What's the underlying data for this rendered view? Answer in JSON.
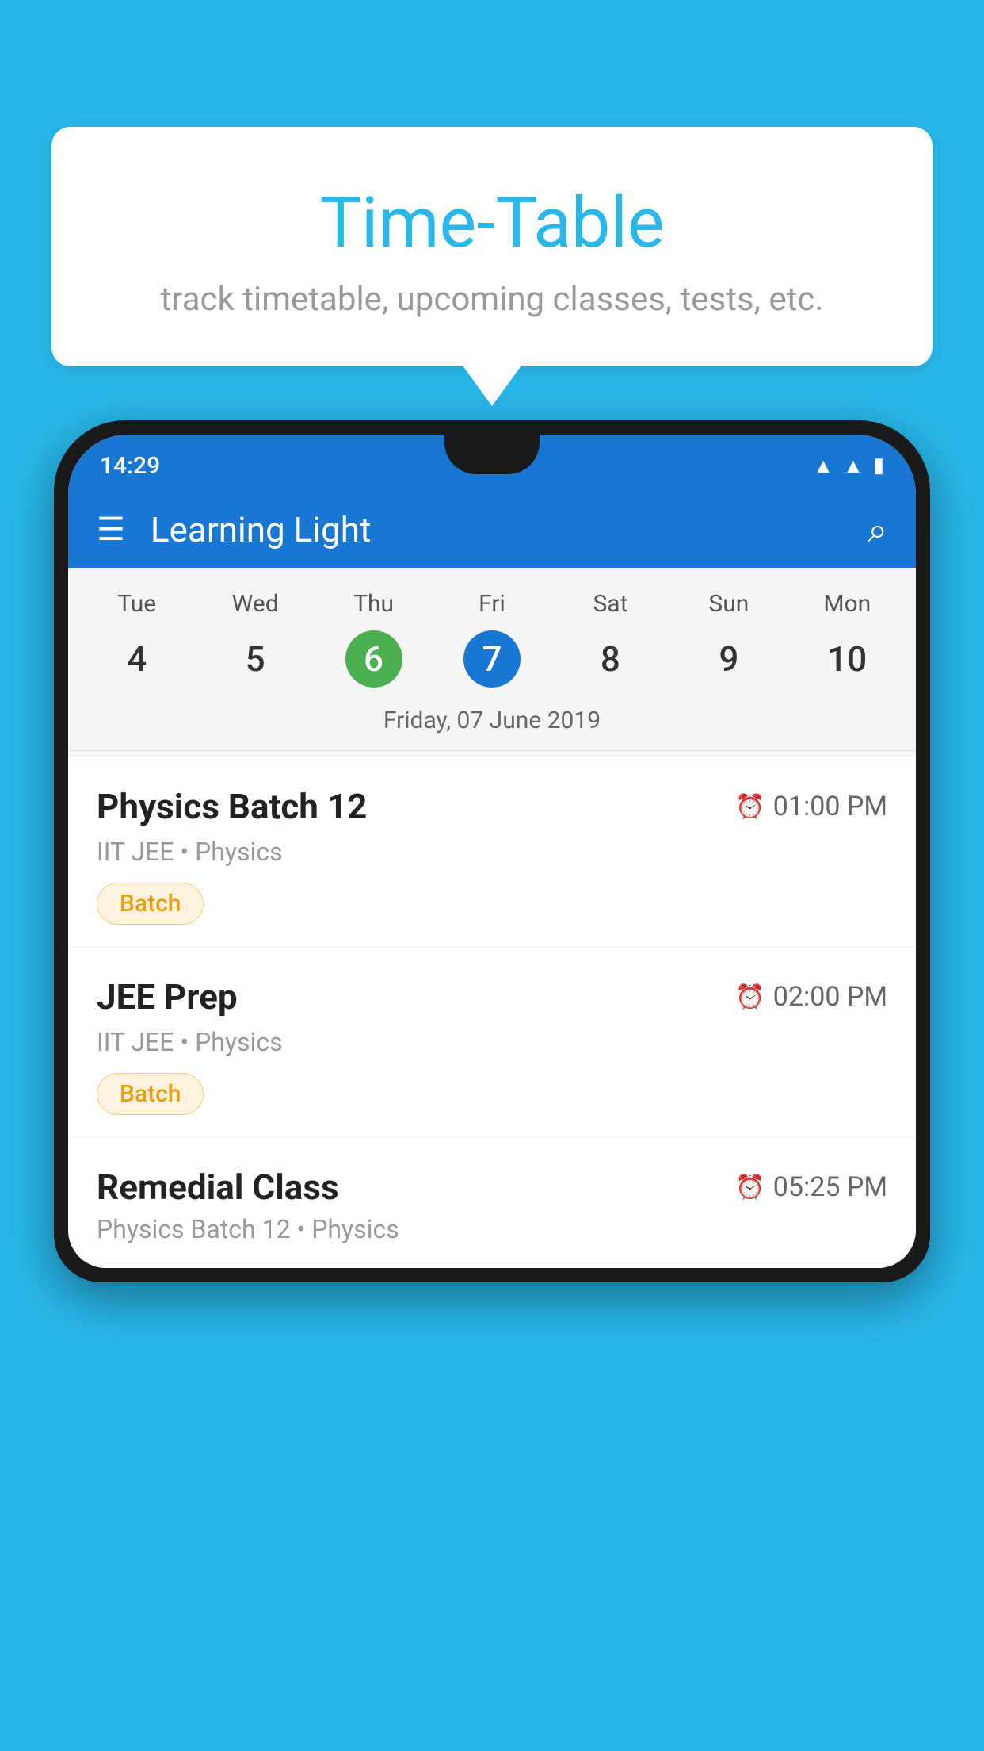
{
  "background_color": "#29B6E8",
  "tooltip": {
    "title": "Time-Table",
    "subtitle": "track timetable, upcoming classes, tests, etc."
  },
  "status_bar": {
    "time": "14:29",
    "icons": [
      "wifi",
      "signal",
      "battery"
    ]
  },
  "app_bar": {
    "title": "Learning Light",
    "menu_icon": "☰",
    "search_icon": "🔍"
  },
  "calendar": {
    "days": [
      {
        "label": "Tue",
        "num": "4"
      },
      {
        "label": "Wed",
        "num": "5"
      },
      {
        "label": "Thu",
        "num": "6",
        "state": "today"
      },
      {
        "label": "Fri",
        "num": "7",
        "state": "selected"
      },
      {
        "label": "Sat",
        "num": "8"
      },
      {
        "label": "Sun",
        "num": "9"
      },
      {
        "label": "Mon",
        "num": "10"
      }
    ],
    "selected_date": "Friday, 07 June 2019"
  },
  "schedule": [
    {
      "id": 1,
      "title": "Physics Batch 12",
      "time": "01:00 PM",
      "subtitle": "IIT JEE • Physics",
      "tag": "Batch"
    },
    {
      "id": 2,
      "title": "JEE Prep",
      "time": "02:00 PM",
      "subtitle": "IIT JEE • Physics",
      "tag": "Batch"
    },
    {
      "id": 3,
      "title": "Remedial Class",
      "time": "05:25 PM",
      "subtitle": "Physics Batch 12 • Physics",
      "tag": null
    }
  ]
}
